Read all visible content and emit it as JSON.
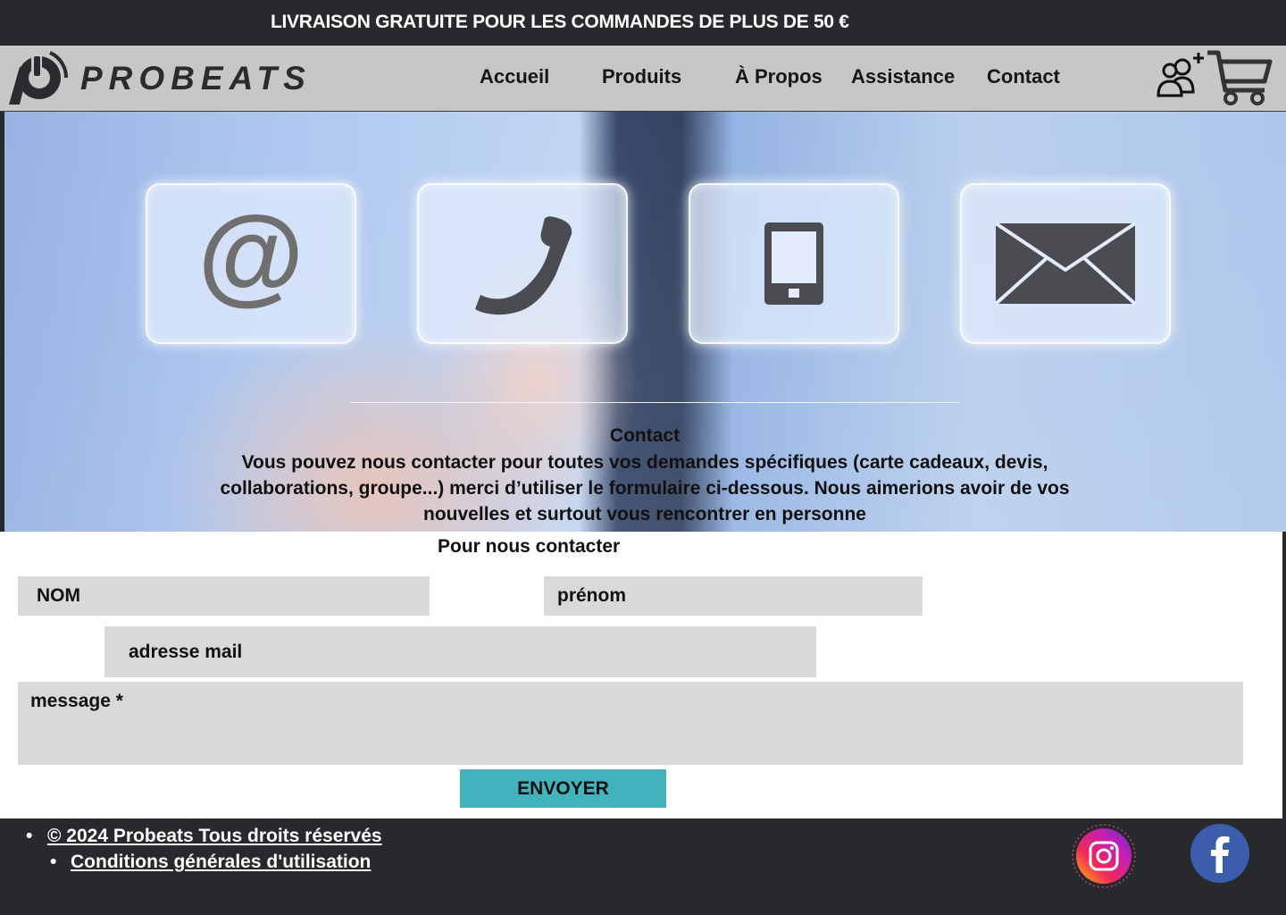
{
  "banner": {
    "text": "LIVRAISON GRATUITE POUR LES COMMANDES DE PLUS DE 50 €"
  },
  "header": {
    "logo_text": "PROBEATS",
    "nav": [
      {
        "label": "Accueil"
      },
      {
        "label": "Produits"
      },
      {
        "label": "À Propos"
      },
      {
        "label": "Assistance"
      },
      {
        "label": "Contact"
      }
    ],
    "icons": [
      "user-add-icon",
      "cart-icon"
    ]
  },
  "hero": {
    "tiles": [
      "at-sign-icon",
      "phone-icon",
      "tablet-icon",
      "envelope-icon"
    ],
    "title": "Contact",
    "text": "Vous pouvez nous contacter pour toutes vos demandes spécifiques (carte cadeaux, devis, collaborations, groupe...) merci d’utiliser le formulaire ci-dessous. Nous aimerions avoir de vos nouvelles et surtout vous rencontrer en personne",
    "at_symbol": "@"
  },
  "form": {
    "title": "Pour nous contacter",
    "nom_placeholder": "NOM",
    "prenom_placeholder": "prénom",
    "email_placeholder": "adresse mail",
    "message_placeholder": "message *",
    "submit_label": "ENVOYER"
  },
  "footer": {
    "copyright": "© 2024  Probeats Tous droits réservés",
    "terms": "Conditions générales d'utilisation",
    "social": [
      "instagram-icon",
      "facebook-icon"
    ]
  },
  "colors": {
    "dark": "#27292c",
    "nav_bg": "#c6c7c6",
    "field_bg": "#d9d9d9",
    "button": "#42b2bc"
  }
}
